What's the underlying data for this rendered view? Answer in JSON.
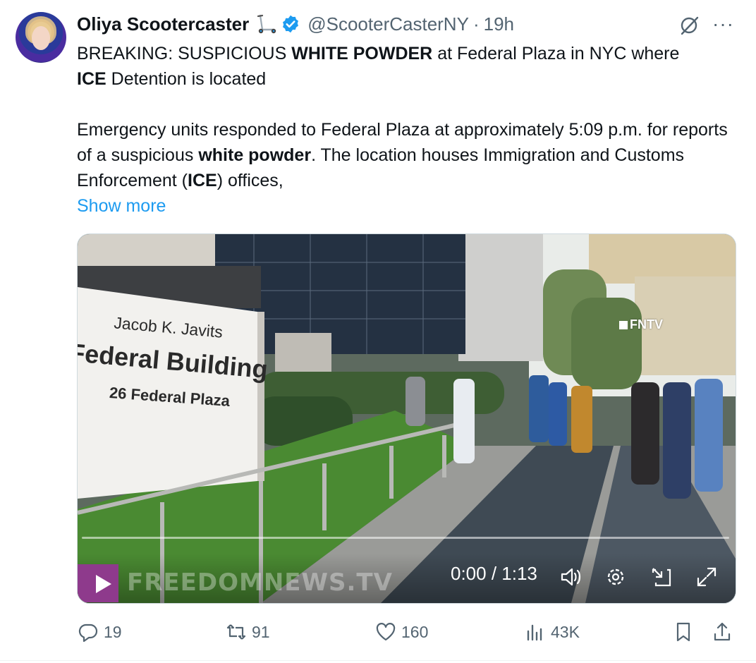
{
  "tweet": {
    "author_name": "Oliya Scootercaster",
    "handle": "@ScooterCasterNY",
    "separator": "·",
    "time_ago": "19h",
    "more_label": "···",
    "line1_prefix": "BREAKING:  SUSPICIOUS ",
    "line1_bold1": "WHITE POWDER",
    "line1_mid": " at Federal Plaza in NYC where ",
    "line2_bold": "ICE",
    "line2_rest": " Detention  is located",
    "para2_a": " Emergency units responded to Federal Plaza at approximately 5:09 p.m. for reports of a suspicious ",
    "para2_bold1": "white powder",
    "para2_b": ". The location houses Immigration and Customs Enforcement (",
    "para2_bold2": "ICE",
    "para2_c": ") offices,",
    "show_more": "Show more"
  },
  "video": {
    "sign_line1": "Jacob K. Javits",
    "sign_line2": "Federal Building",
    "sign_line3": "26 Federal Plaza",
    "channel_tag": "FNTV",
    "watermark": "FREEDOMNEWS.TV",
    "time_display": "0:00 / 1:13",
    "progress": 0.0
  },
  "actions": {
    "replies": "19",
    "reposts": "91",
    "likes": "160",
    "views": "43K"
  },
  "colors": {
    "link": "#1d9bf0",
    "verified": "#1d9bf0",
    "muted": "#536471",
    "text": "#0f1419",
    "play_accent": "#8e3a8c"
  },
  "icons": {
    "emoji": "scooter-icon",
    "verified": "verified-badge-icon",
    "grok": "grok-icon",
    "reply": "reply-icon",
    "repost": "repost-icon",
    "like": "heart-icon",
    "views": "views-icon",
    "bookmark": "bookmark-icon",
    "share": "share-icon",
    "volume": "volume-icon",
    "settings": "settings-icon",
    "pip": "picture-in-picture-icon",
    "fullscreen": "fullscreen-icon"
  }
}
